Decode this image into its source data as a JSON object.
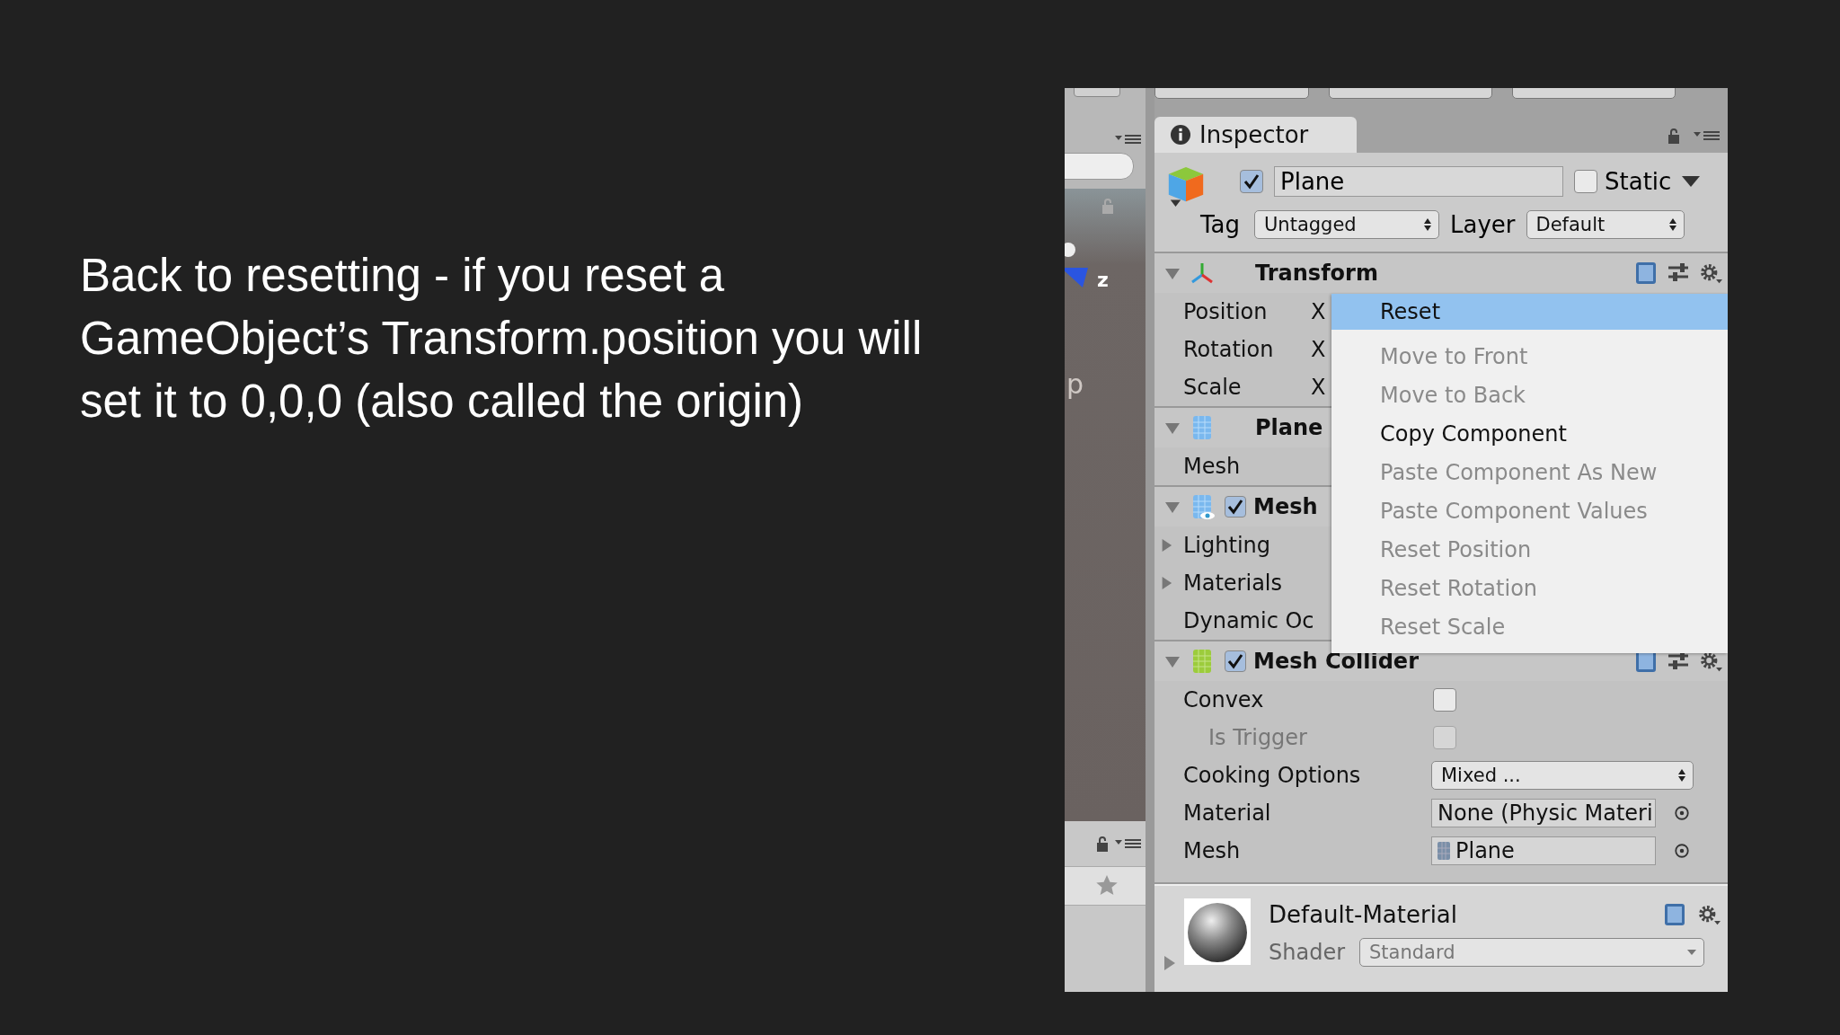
{
  "slide": {
    "text": "Back to resetting - if you reset a GameObject’s Transform.position you will set it to 0,0,0 (also called the origin)"
  },
  "scene_view": {
    "axis_label": "z",
    "cut_label": "p"
  },
  "inspector": {
    "tab": "Inspector",
    "object": {
      "active": true,
      "name": "Plane",
      "static": false,
      "static_label": "Static",
      "tag_label": "Tag",
      "tag": "Untagged",
      "layer_label": "Layer",
      "layer": "Default"
    },
    "components": [
      {
        "kind": "transform",
        "title": "Transform",
        "expanded": true,
        "header_icons": true,
        "rows": [
          {
            "kind": "axis",
            "label": "Position",
            "value": "X"
          },
          {
            "kind": "axis",
            "label": "Rotation",
            "value": "X"
          },
          {
            "kind": "axis",
            "label": "Scale",
            "value": "X"
          }
        ]
      },
      {
        "kind": "mesh_filter",
        "title": "Plane",
        "expanded": true,
        "header_icons": false,
        "rows": [
          {
            "kind": "plain",
            "label": "Mesh"
          }
        ]
      },
      {
        "kind": "mesh_renderer",
        "title": "Mesh",
        "enabled": true,
        "expanded": true,
        "header_icons": false,
        "rows": [
          {
            "kind": "foldout",
            "label": "Lighting",
            "expanded": false
          },
          {
            "kind": "foldout",
            "label": "Materials",
            "expanded": false
          },
          {
            "kind": "plain",
            "label": "Dynamic Oc"
          }
        ]
      },
      {
        "kind": "mesh_collider",
        "title": "Mesh Collider",
        "enabled": true,
        "expanded": true,
        "header_icons": true,
        "rows": [
          {
            "kind": "checkbox",
            "label": "Convex",
            "checked": false,
            "disabled": false
          },
          {
            "kind": "checkbox",
            "label": "Is Trigger",
            "checked": false,
            "disabled": true
          },
          {
            "kind": "dropdown",
            "label": "Cooking Options",
            "value": "Mixed ..."
          },
          {
            "kind": "object",
            "label": "Material",
            "value": "None (Physic Materi",
            "has_icon": false
          },
          {
            "kind": "object",
            "label": "Mesh",
            "value": "Plane",
            "has_icon": true
          }
        ]
      }
    ],
    "material": {
      "name": "Default-Material",
      "shader_label": "Shader",
      "shader": "Standard",
      "expanded": false
    }
  },
  "context_menu": {
    "items": [
      {
        "label": "Reset",
        "selected": true,
        "disabled": false
      },
      {
        "label": "Move to Front",
        "selected": false,
        "disabled": true
      },
      {
        "label": "Move to Back",
        "selected": false,
        "disabled": true
      },
      {
        "label": "Copy Component",
        "selected": false,
        "disabled": false
      },
      {
        "label": "Paste Component As New",
        "selected": false,
        "disabled": true
      },
      {
        "label": "Paste Component Values",
        "selected": false,
        "disabled": true
      },
      {
        "label": "Reset Position",
        "selected": false,
        "disabled": true
      },
      {
        "label": "Reset Rotation",
        "selected": false,
        "disabled": true
      },
      {
        "label": "Reset Scale",
        "selected": false,
        "disabled": true
      }
    ]
  }
}
